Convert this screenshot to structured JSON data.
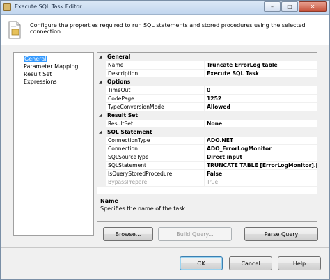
{
  "window": {
    "title": "Execute SQL Task Editor"
  },
  "titlebar_buttons": {
    "minimize": "–",
    "maximize": "□",
    "close": "✕"
  },
  "header": {
    "text": "Configure the properties required to run SQL statements and stored procedures using the selected connection."
  },
  "nav": {
    "items": [
      {
        "label": "General",
        "selected": true
      },
      {
        "label": "Parameter Mapping"
      },
      {
        "label": "Result Set"
      },
      {
        "label": "Expressions"
      }
    ]
  },
  "grid": {
    "cat_general": "General",
    "name_label": "Name",
    "name_value": "Truncate ErrorLog table",
    "desc_label": "Description",
    "desc_value": "Execute SQL Task",
    "cat_options": "Options",
    "timeout_label": "TimeOut",
    "timeout_value": "0",
    "codepage_label": "CodePage",
    "codepage_value": "1252",
    "typeconv_label": "TypeConversionMode",
    "typeconv_value": "Allowed",
    "cat_resultset": "Result Set",
    "resultset_label": "ResultSet",
    "resultset_value": "None",
    "cat_sql": "SQL Statement",
    "conntype_label": "ConnectionType",
    "conntype_value": "ADO.NET",
    "connection_label": "Connection",
    "connection_value": "ADO_ErrorLogMonitor",
    "sqlsource_label": "SQLSourceType",
    "sqlsource_value": "Direct input",
    "sqlstmt_label": "SQLStatement",
    "sqlstmt_value": "TRUNCATE TABLE [ErrorLogMonitor].[dbo].[Err",
    "isquery_label": "IsQueryStoredProcedure",
    "isquery_value": "False",
    "bypass_label": "BypassPrepare",
    "bypass_value": "True"
  },
  "description_panel": {
    "title": "Name",
    "text": "Specifies the name of the task."
  },
  "buttons": {
    "browse": "Browse...",
    "build_query": "Build Query...",
    "parse_query": "Parse Query",
    "ok": "OK",
    "cancel": "Cancel",
    "help": "Help"
  }
}
